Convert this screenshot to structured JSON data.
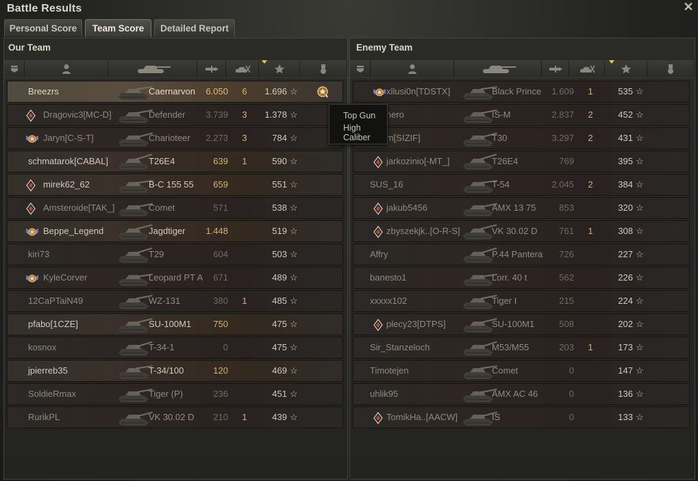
{
  "window": {
    "title": "Battle Results"
  },
  "tabs": [
    {
      "label": "Personal Score",
      "active": false
    },
    {
      "label": "Team Score",
      "active": true
    },
    {
      "label": "Detailed Report",
      "active": false
    }
  ],
  "columns": [
    "squad-icon",
    "player-icon",
    "tank-icon",
    "damage-icon",
    "kills-icon",
    "experience-star-icon",
    "medal-icon"
  ],
  "tooltip": {
    "lines": [
      "Top Gun",
      "High Caliber"
    ]
  },
  "our_team": {
    "title": "Our Team",
    "rows": [
      {
        "name": "Breezrs",
        "tank": "Caernarvon",
        "damage": "6.050",
        "kills": "6",
        "xp": "1.696",
        "badge": "",
        "alive": true,
        "self": true,
        "medal": true
      },
      {
        "name": "Dragovic3[MC-D]",
        "tank": "Defender",
        "damage": "3.739",
        "kills": "3",
        "xp": "1.378",
        "badge": "diamond",
        "alive": false
      },
      {
        "name": "Jaryn[C-S-T]",
        "tank": "Charioteer",
        "damage": "2.273",
        "kills": "3",
        "xp": "784",
        "badge": "wings",
        "alive": false
      },
      {
        "name": "schmatarok[CABAL]",
        "tank": "T26E4",
        "damage": "639",
        "kills": "1",
        "xp": "590",
        "badge": "",
        "alive": true
      },
      {
        "name": "mirek62_62",
        "tank": "B-C 155 55",
        "damage": "659",
        "kills": "",
        "xp": "551",
        "badge": "diamond",
        "alive": true
      },
      {
        "name": "Amsteroide[TAK_]",
        "tank": "Comet",
        "damage": "571",
        "kills": "",
        "xp": "538",
        "badge": "diamond",
        "alive": false
      },
      {
        "name": "Beppe_Legend",
        "tank": "Jagdtiger",
        "damage": "1.448",
        "kills": "",
        "xp": "519",
        "badge": "wings",
        "alive": true
      },
      {
        "name": "kiri73",
        "tank": "T29",
        "damage": "604",
        "kills": "",
        "xp": "503",
        "badge": "",
        "alive": false
      },
      {
        "name": "KyleCorver",
        "tank": "Leopard PT A",
        "damage": "671",
        "kills": "",
        "xp": "489",
        "badge": "wings",
        "alive": false
      },
      {
        "name": "12CaPTaiN49",
        "tank": "WZ-131",
        "damage": "380",
        "kills": "1",
        "xp": "485",
        "badge": "",
        "alive": false
      },
      {
        "name": "pfabo[1CZE]",
        "tank": "SU-100M1",
        "damage": "750",
        "kills": "",
        "xp": "475",
        "badge": "",
        "alive": true
      },
      {
        "name": "kosnox",
        "tank": "T-34-1",
        "damage": "0",
        "kills": "",
        "xp": "475",
        "badge": "",
        "alive": false
      },
      {
        "name": "jpierreb35",
        "tank": "T-34/100",
        "damage": "120",
        "kills": "",
        "xp": "469",
        "badge": "",
        "alive": true
      },
      {
        "name": "SoldieRmax",
        "tank": "Tiger (P)",
        "damage": "236",
        "kills": "",
        "xp": "451",
        "badge": "",
        "alive": false
      },
      {
        "name": "RurikPL",
        "tank": "VK 30.02 D",
        "damage": "210",
        "kills": "1",
        "xp": "439",
        "badge": "",
        "alive": false
      }
    ]
  },
  "enemy_team": {
    "title": "Enemy Team",
    "rows": [
      {
        "name": "xllusi0n[TDSTX]",
        "tank": "Black Prince",
        "damage": "1.609",
        "kills": "1",
        "xp": "535",
        "badge": "wings",
        "alive": false
      },
      {
        "name": "rzellhero",
        "tank": "IS-M",
        "damage": "2.837",
        "kills": "2",
        "xp": "452",
        "badge": "",
        "alive": false
      },
      {
        "name": "lekom[SIZIF]",
        "tank": "T30",
        "damage": "3.297",
        "kills": "2",
        "xp": "431",
        "badge": "",
        "alive": false
      },
      {
        "name": "jarkozinio[-MT_]",
        "tank": "T26E4",
        "damage": "769",
        "kills": "",
        "xp": "395",
        "badge": "diamond",
        "alive": false
      },
      {
        "name": "SUS_16",
        "tank": "T-54",
        "damage": "2.045",
        "kills": "2",
        "xp": "384",
        "badge": "",
        "alive": false
      },
      {
        "name": "jakub5456",
        "tank": "AMX 13 75",
        "damage": "853",
        "kills": "",
        "xp": "320",
        "badge": "diamond",
        "alive": false
      },
      {
        "name": "zbyszekjk..[O-R-S]",
        "tank": "VK 30.02 D",
        "damage": "761",
        "kills": "1",
        "xp": "308",
        "badge": "diamond",
        "alive": false
      },
      {
        "name": "Affry",
        "tank": "P.44 Pantera",
        "damage": "726",
        "kills": "",
        "xp": "227",
        "badge": "",
        "alive": false
      },
      {
        "name": "banesto1",
        "tank": "Lorr. 40 t",
        "damage": "562",
        "kills": "",
        "xp": "226",
        "badge": "",
        "alive": false
      },
      {
        "name": "xxxxx102",
        "tank": "Tiger I",
        "damage": "215",
        "kills": "",
        "xp": "224",
        "badge": "",
        "alive": false
      },
      {
        "name": "plecy23[DTPS]",
        "tank": "SU-100M1",
        "damage": "508",
        "kills": "",
        "xp": "202",
        "badge": "diamond",
        "alive": false
      },
      {
        "name": "Sir_Stanzeloch",
        "tank": "M53/M55",
        "damage": "203",
        "kills": "1",
        "xp": "173",
        "badge": "",
        "alive": false
      },
      {
        "name": "Timotejen",
        "tank": "Comet",
        "damage": "0",
        "kills": "",
        "xp": "147",
        "badge": "",
        "alive": false
      },
      {
        "name": "uhlik95",
        "tank": "AMX AC 46",
        "damage": "0",
        "kills": "",
        "xp": "136",
        "badge": "",
        "alive": false
      },
      {
        "name": "TomikHa..[AACW]",
        "tank": "IS",
        "damage": "0",
        "kills": "",
        "xp": "133",
        "badge": "diamond",
        "alive": false
      }
    ]
  }
}
